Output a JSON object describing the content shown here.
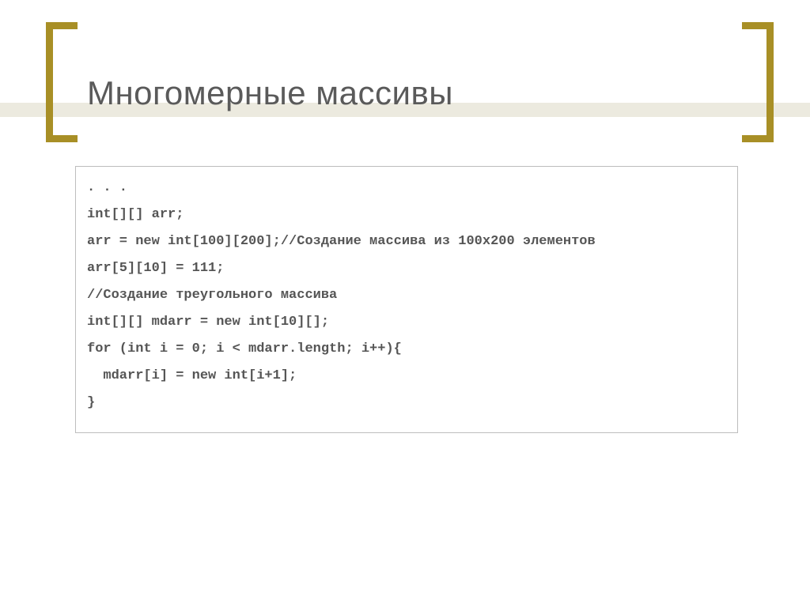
{
  "title": "Многомерные массивы",
  "code": {
    "l0": ". . .",
    "l1": "int[][] arr;",
    "l2": "arr = new int[100][200];//Создание массива из 100x200 элементов",
    "l3": "arr[5][10] = 111;",
    "l4": "//Создание треугольного массива",
    "l5": "int[][] mdarr = new int[10][];",
    "l6": "for (int i = 0; i < mdarr.length; i++){",
    "l7": "  mdarr[i] = new int[i+1];",
    "l8": "}"
  }
}
